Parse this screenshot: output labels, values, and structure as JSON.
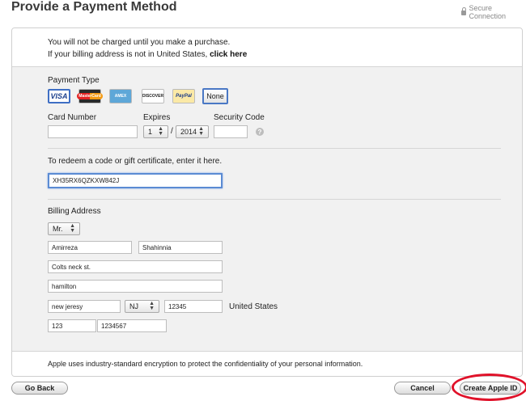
{
  "header": {
    "title": "Provide a Payment Method",
    "secure_label": "Secure Connection"
  },
  "notice": {
    "line1": "You will not be charged until you make a purchase.",
    "line2_prefix": "If your billing address is not in United States,",
    "line2_link": "click here"
  },
  "payment_type": {
    "label": "Payment Type",
    "cards": [
      {
        "name": "visa",
        "text": "VISA"
      },
      {
        "name": "mastercard",
        "text": "MasterCard"
      },
      {
        "name": "amex",
        "text": "AMEX"
      },
      {
        "name": "discover",
        "text": "DISCOVER"
      },
      {
        "name": "paypal",
        "text": "PayPal"
      }
    ],
    "none_label": "None"
  },
  "card_fields": {
    "card_number_label": "Card Number",
    "card_number_value": "",
    "expires_label": "Expires",
    "month_value": "1",
    "separator": "/",
    "year_value": "2014",
    "security_label": "Security Code",
    "security_value": "",
    "help_glyph": "?"
  },
  "redeem": {
    "label": "To redeem a code or gift certificate, enter it here.",
    "value": "XH35RX6QZKXW842J"
  },
  "billing": {
    "label": "Billing Address",
    "title_value": "Mr.",
    "first_name": "Amirreza",
    "last_name": "Shahinnia",
    "street": "Colts neck st.",
    "street2": "hamilton",
    "city": "new jeresy",
    "state": "NJ",
    "zip": "12345",
    "country": "United States",
    "area_code": "123",
    "phone": "1234567"
  },
  "footer_note": "Apple uses industry-standard encryption to protect the confidentiality of your personal information.",
  "actions": {
    "back": "Go Back",
    "cancel": "Cancel",
    "create": "Create Apple ID"
  },
  "colors": {
    "focus": "#5b8bd3",
    "highlight_circle": "#e0122a"
  }
}
